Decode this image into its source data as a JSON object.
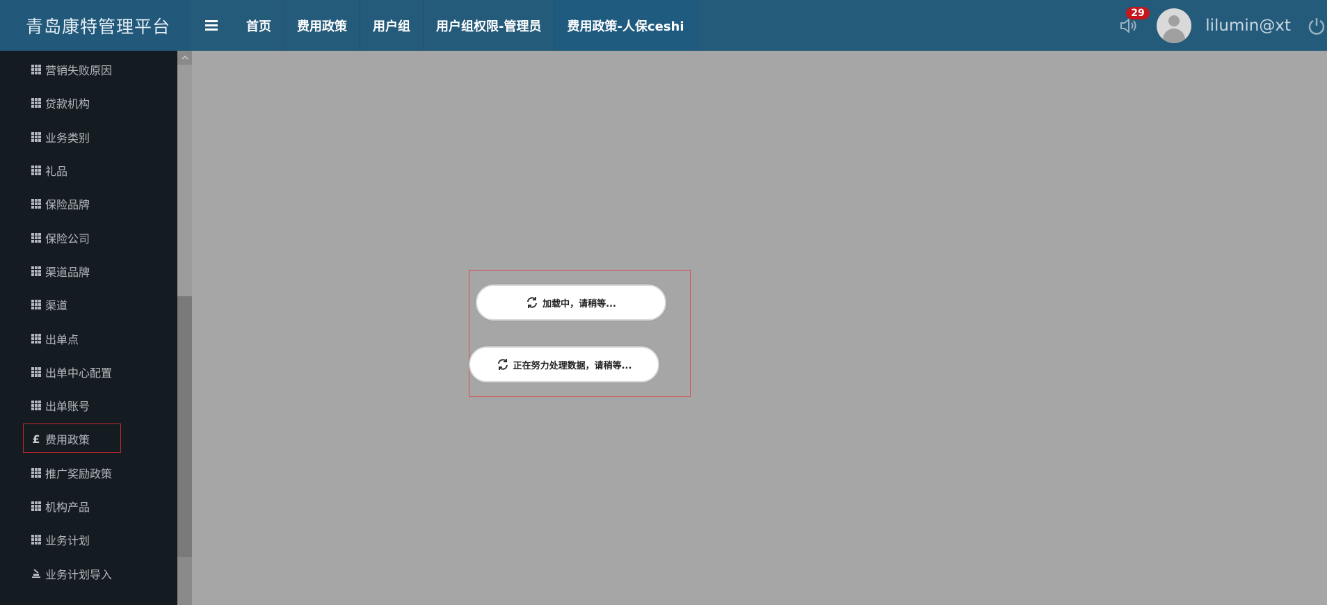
{
  "header": {
    "brand": "青岛康特管理平台",
    "tabs": [
      {
        "label": "首页"
      },
      {
        "label": "费用政策"
      },
      {
        "label": "用户组"
      },
      {
        "label": "用户组权限-管理员"
      },
      {
        "label": "费用政策-人保ceshi"
      }
    ],
    "notification_count": "29",
    "username": "lilumin@xt"
  },
  "sidebar": {
    "items": [
      {
        "label": "营销失败原因",
        "icon": "grid-icon"
      },
      {
        "label": "贷款机构",
        "icon": "grid-icon"
      },
      {
        "label": "业务类别",
        "icon": "grid-icon"
      },
      {
        "label": "礼品",
        "icon": "grid-icon"
      },
      {
        "label": "保险品牌",
        "icon": "grid-icon"
      },
      {
        "label": "保险公司",
        "icon": "grid-icon"
      },
      {
        "label": "渠道品牌",
        "icon": "grid-icon"
      },
      {
        "label": "渠道",
        "icon": "grid-icon"
      },
      {
        "label": "出单点",
        "icon": "grid-icon"
      },
      {
        "label": "出单中心配置",
        "icon": "grid-icon"
      },
      {
        "label": "出单账号",
        "icon": "grid-icon"
      },
      {
        "label": "费用政策",
        "icon": "pound-icon"
      },
      {
        "label": "推广奖励政策",
        "icon": "grid-icon"
      },
      {
        "label": "机构产品",
        "icon": "grid-icon"
      },
      {
        "label": "业务计划",
        "icon": "grid-icon"
      },
      {
        "label": "业务计划导入",
        "icon": "import-icon"
      }
    ],
    "pound_symbol": "£"
  },
  "main": {
    "loading_text": "加载中，请稍等...",
    "processing_text": "正在努力处理数据，请稍等..."
  }
}
